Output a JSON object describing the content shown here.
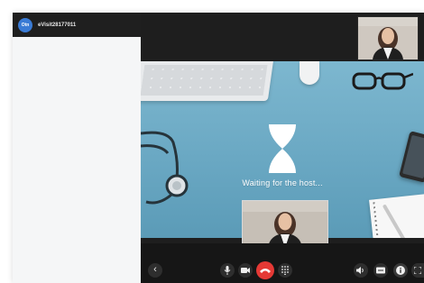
{
  "header": {
    "logo_text": "Otn",
    "visit_id": "eVisit28177011"
  },
  "stage": {
    "status_text": "Waiting for the host..."
  },
  "controls": {
    "back_glyph": "‹"
  },
  "colors": {
    "hangup": "#e53935",
    "desk_blue": "#6aa8c3",
    "logo_blue": "#3a7bd5"
  },
  "icons": [
    "hourglass-icon",
    "chevron-left-icon",
    "microphone-icon",
    "camera-icon",
    "hang-up-icon",
    "keypad-icon",
    "volume-icon",
    "closed-caption-icon",
    "info-icon",
    "fullscreen-icon"
  ]
}
